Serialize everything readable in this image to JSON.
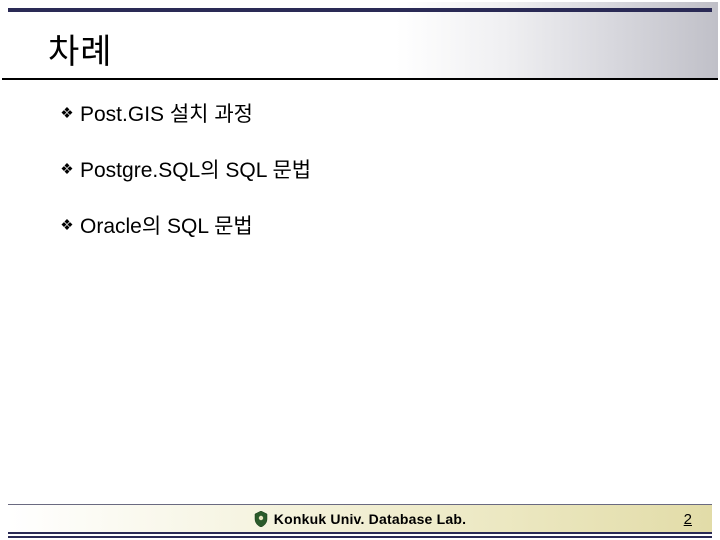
{
  "title": "차례",
  "bullets": [
    {
      "icon": "❖",
      "text": "Post.GIS 설치 과정"
    },
    {
      "icon": "❖",
      "text": "Postgre.SQL의 SQL 문법"
    },
    {
      "icon": "❖",
      "text": "Oracle의 SQL 문법"
    }
  ],
  "footer": {
    "logo_label": "konkuk-crest",
    "text": "Konkuk Univ. Database Lab."
  },
  "page_number": "2"
}
